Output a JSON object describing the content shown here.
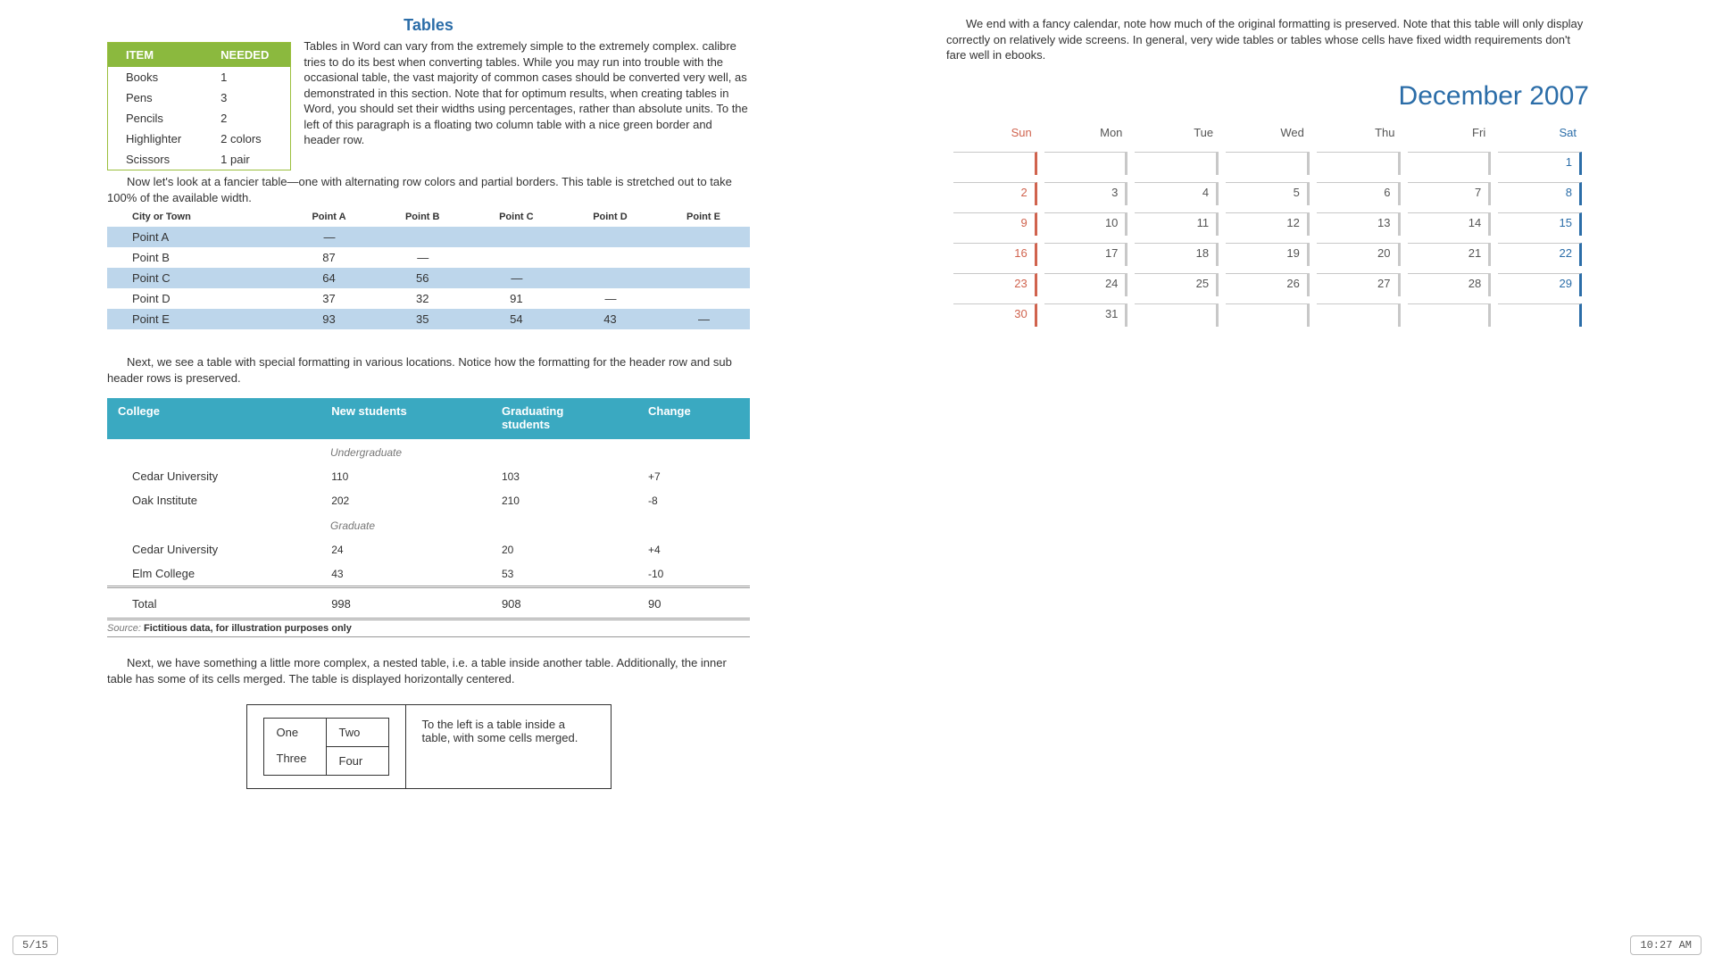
{
  "title": "Tables",
  "intro": "Tables in Word can vary from the extremely simple to the extremely complex. calibre tries to do its best when converting tables. While you may run into trouble with the occasional table, the vast majority of common cases should be converted very well, as demonstrated in this section. Note that for optimum results, when creating tables in Word, you should set their widths using percentages, rather than absolute units. To the left of this paragraph is a floating two column table with a nice green border and header row.",
  "green_table": {
    "headers": [
      "ITEM",
      "NEEDED"
    ],
    "rows": [
      [
        "Books",
        "1"
      ],
      [
        "Pens",
        "3"
      ],
      [
        "Pencils",
        "2"
      ],
      [
        "Highlighter",
        "2 colors"
      ],
      [
        "Scissors",
        "1 pair"
      ]
    ]
  },
  "para2": "Now let's look at a fancier table—one with alternating row colors and partial borders. This table is stretched out to take 100% of the available width.",
  "dist_table": {
    "headers": [
      "City or Town",
      "Point A",
      "Point B",
      "Point C",
      "Point D",
      "Point E"
    ],
    "rows": [
      [
        "Point A",
        "—",
        "",
        "",
        "",
        ""
      ],
      [
        "Point B",
        "87",
        "—",
        "",
        "",
        ""
      ],
      [
        "Point C",
        "64",
        "56",
        "—",
        "",
        ""
      ],
      [
        "Point D",
        "37",
        "32",
        "91",
        "—",
        ""
      ],
      [
        "Point E",
        "93",
        "35",
        "54",
        "43",
        "—"
      ]
    ]
  },
  "para3": "Next, we see a table with special formatting in various locations. Notice how the formatting for the header row and sub header rows is preserved.",
  "college_table": {
    "headers": [
      "College",
      "New students",
      "Graduating students",
      "Change"
    ],
    "sub1": "Undergraduate",
    "rows1": [
      [
        "Cedar University",
        "110",
        "103",
        "+7"
      ],
      [
        "Oak Institute",
        "202",
        "210",
        "-8"
      ]
    ],
    "sub2": "Graduate",
    "rows2": [
      [
        "Cedar University",
        "24",
        "20",
        "+4"
      ],
      [
        "Elm College",
        "43",
        "53",
        "-10"
      ]
    ],
    "total": [
      "Total",
      "998",
      "908",
      "90"
    ]
  },
  "source_label": "Source:",
  "source_text": " Fictitious data, for illustration purposes only",
  "para4": "Next, we have something a little more complex, a nested table, i.e. a table inside another table. Additionally, the inner table has some of its cells merged. The table is displayed horizontally centered.",
  "nested": {
    "one": "One",
    "two": "Two",
    "three": "Three",
    "four": "Four",
    "caption": "To the left is a table inside a table, with some cells merged."
  },
  "right_intro": "We end with a fancy calendar, note how much of the original formatting is preserved. Note that this table will only display correctly on relatively wide screens. In general, very wide tables or tables whose cells have fixed width requirements don't fare well in ebooks.",
  "calendar": {
    "title": "December 2007",
    "days": [
      "Sun",
      "Mon",
      "Tue",
      "Wed",
      "Thu",
      "Fri",
      "Sat"
    ],
    "weeks": [
      [
        "",
        "",
        "",
        "",
        "",
        "",
        "1"
      ],
      [
        "2",
        "3",
        "4",
        "5",
        "6",
        "7",
        "8"
      ],
      [
        "9",
        "10",
        "11",
        "12",
        "13",
        "14",
        "15"
      ],
      [
        "16",
        "17",
        "18",
        "19",
        "20",
        "21",
        "22"
      ],
      [
        "23",
        "24",
        "25",
        "26",
        "27",
        "28",
        "29"
      ],
      [
        "30",
        "31",
        "",
        "",
        "",
        "",
        ""
      ]
    ]
  },
  "page_counter": "5/15",
  "clock": "10:27 AM"
}
